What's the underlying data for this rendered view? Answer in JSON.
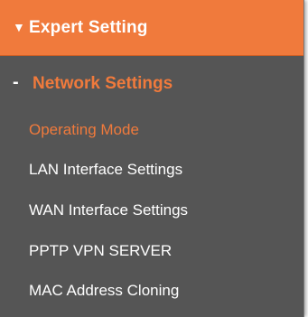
{
  "menu": {
    "header": {
      "arrow_icon": "triangle-down-icon",
      "label": "Expert Setting"
    },
    "section": {
      "marker": "-",
      "label": "Network Settings"
    },
    "items": [
      {
        "label": "Operating Mode",
        "active": true
      },
      {
        "label": "LAN Interface Settings",
        "active": false
      },
      {
        "label": "WAN Interface Settings",
        "active": false
      },
      {
        "label": "PPTP VPN SERVER",
        "active": false
      },
      {
        "label": "MAC Address Cloning",
        "active": false
      }
    ]
  },
  "colors": {
    "accent": "#f07a3c",
    "panel_bg": "#555555",
    "text": "#ffffff"
  }
}
